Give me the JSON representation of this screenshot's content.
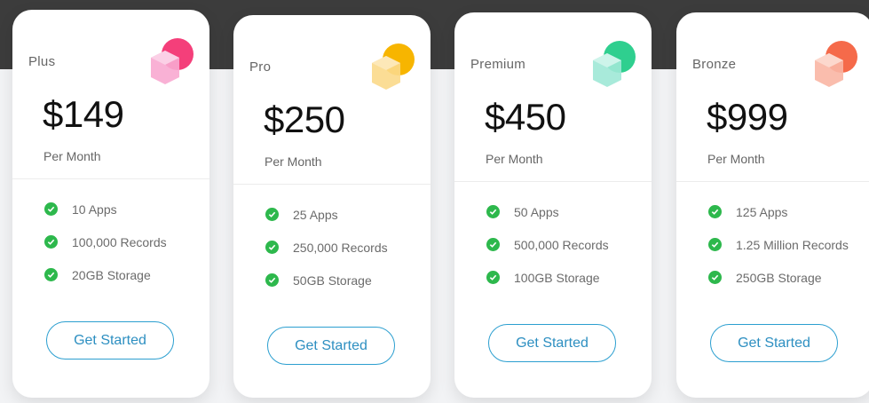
{
  "plans": [
    {
      "name": "Plus",
      "price": "$149",
      "period": "Per Month",
      "features": [
        "10 Apps",
        "100,000 Records",
        "20GB Storage"
      ],
      "cta": "Get Started",
      "accent": "#f43f7a",
      "cube": "#f8a8d0",
      "icon": "pink-cube-icon"
    },
    {
      "name": "Pro",
      "price": "$250",
      "period": "Per Month",
      "features": [
        "25 Apps",
        "250,000 Records",
        "50GB Storage"
      ],
      "cta": "Get Started",
      "accent": "#f7b500",
      "cube": "#fbd98a",
      "icon": "yellow-cube-icon"
    },
    {
      "name": "Premium",
      "price": "$450",
      "period": "Per Month",
      "features": [
        "50 Apps",
        "500,000 Records",
        "100GB Storage"
      ],
      "cta": "Get Started",
      "accent": "#2fcf8f",
      "cube": "#9ee8d6",
      "icon": "green-cube-icon"
    },
    {
      "name": "Bronze",
      "price": "$999",
      "period": "Per Month",
      "features": [
        "125 Apps",
        "1.25 Million Records",
        "250GB Storage"
      ],
      "cta": "Get Started",
      "accent": "#f56a4a",
      "cube": "#f9b6a4",
      "icon": "orange-cube-icon"
    }
  ],
  "colors": {
    "check": "#2db84c",
    "button_border": "#2c9fd0"
  }
}
